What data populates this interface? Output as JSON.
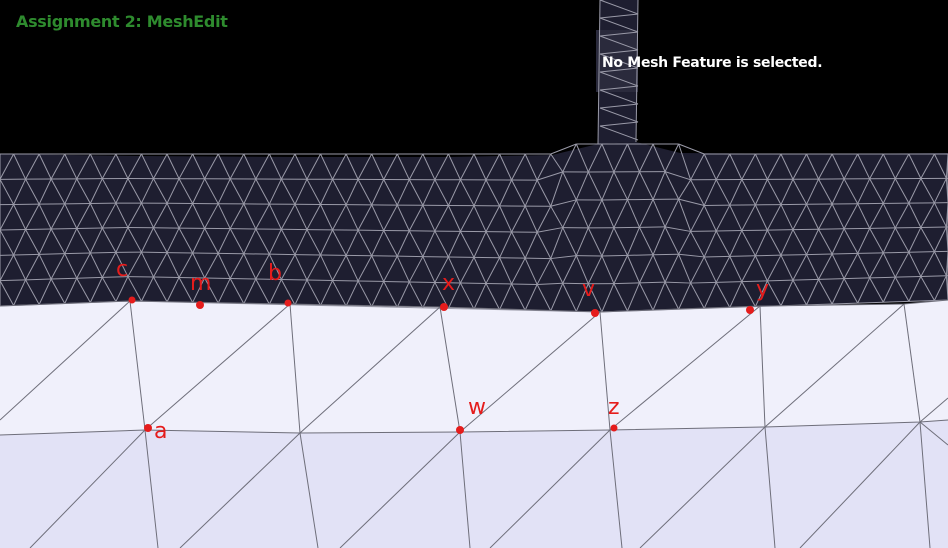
{
  "app": {
    "title": "Assignment 2: MeshEdit"
  },
  "status": {
    "message": "No Mesh Feature is selected."
  },
  "annotations": {
    "color": "#e51c1c",
    "labels": [
      "c",
      "m",
      "b",
      "x",
      "v",
      "y",
      "a",
      "w",
      "z"
    ]
  },
  "colors": {
    "background": "#000000",
    "dark_mesh_fill": "#1e1e30",
    "light_mesh_fill": "#f0f0fb",
    "lower_mesh_fill": "#e2e2f6",
    "mesh_edge": "#9a9aa8"
  }
}
